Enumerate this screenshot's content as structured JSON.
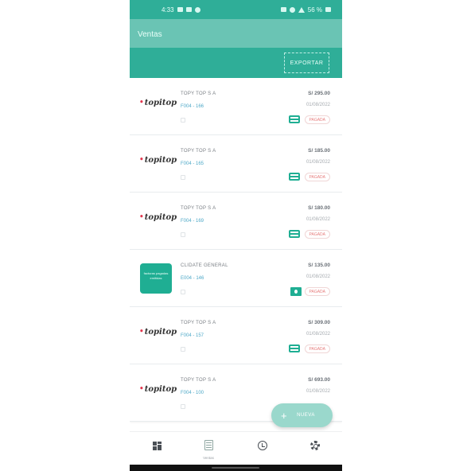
{
  "status_bar": {
    "time": "4:33",
    "battery": "56 %"
  },
  "app_bar": {
    "title": "Ventas"
  },
  "toolbar": {
    "export_label": "EXPORTAR"
  },
  "invoices": [
    {
      "company": "TOPY TOP S A",
      "doc": "F004 - 166",
      "amount": "S/ 295.00",
      "date": "01/08/2022",
      "status": "PAGADA",
      "logo": "topitop",
      "pay_icon": "credit-card-icon"
    },
    {
      "company": "TOPY TOP S A",
      "doc": "F004 - 165",
      "amount": "S/ 185.00",
      "date": "01/08/2022",
      "status": "PAGADA",
      "logo": "topitop",
      "pay_icon": "credit-card-icon"
    },
    {
      "company": "TOPY TOP S A",
      "doc": "F004 - 169",
      "amount": "S/ 180.00",
      "date": "01/08/2022",
      "status": "PAGADA",
      "logo": "topitop",
      "pay_icon": "credit-card-icon"
    },
    {
      "company": "CLIDATE GENERAL",
      "doc": "E004 - 146",
      "amount": "S/ 135.00",
      "date": "01/08/2022",
      "status": "PAGADA",
      "logo": "box",
      "pay_icon": "cash-icon"
    },
    {
      "company": "TOPY TOP S A",
      "doc": "F004 - 157",
      "amount": "S/ 309.00",
      "date": "01/08/2022",
      "status": "PAGADA",
      "logo": "topitop",
      "pay_icon": "credit-card-icon"
    },
    {
      "company": "TOPY TOP S A",
      "doc": "F004 - 100",
      "amount": "S/ 693.00",
      "date": "01/08/2022",
      "status": "",
      "logo": "topitop",
      "pay_icon": ""
    }
  ],
  "logo_text": {
    "topitop": "topitop",
    "box": "facturas pagadas emitidas"
  },
  "fab": {
    "label": "NUEVA"
  },
  "bottom_nav": [
    {
      "name": "dashboard-icon",
      "label": ""
    },
    {
      "name": "sales-icon",
      "label": "Ventas"
    },
    {
      "name": "history-icon",
      "label": ""
    },
    {
      "name": "settings-icon",
      "label": ""
    }
  ],
  "colors": {
    "primary": "#2fae98",
    "appbar": "#6ac4b4",
    "fab": "#9ad8cc",
    "status_paid": "#e77d7d"
  }
}
